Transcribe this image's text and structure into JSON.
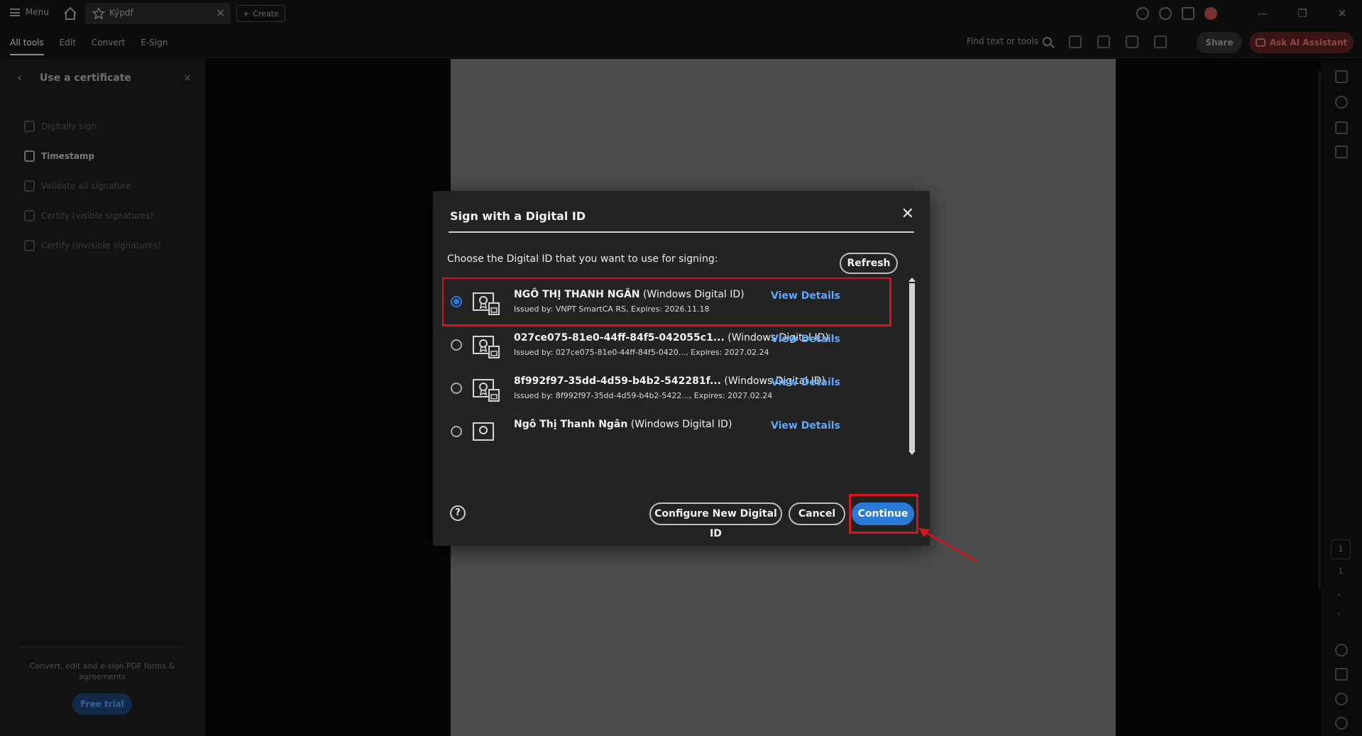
{
  "titlebar": {
    "menu_label": "Menu",
    "tab_label": "Kýpdf",
    "create_label": "Create",
    "window_controls": [
      "—",
      "❐",
      "✕"
    ]
  },
  "toolbar": {
    "tabs": [
      "All tools",
      "Edit",
      "Convert",
      "E-Sign"
    ],
    "find_label": "Find text or tools",
    "share_label": "Share",
    "ai_label": "Ask AI Assistant"
  },
  "left_panel": {
    "title": "Use a certificate",
    "items": [
      {
        "label": "Digitally sign"
      },
      {
        "label": "Timestamp"
      },
      {
        "label": "Validate all signature"
      },
      {
        "label": "Certify (visible signatures)"
      },
      {
        "label": "Certify (invisible signatures)"
      }
    ],
    "promo_text": "Convert, edit and e-sign PDF forms & agreements",
    "trial_label": "Free trial"
  },
  "right_rail": {
    "current_page": "1",
    "total_pages": "1"
  },
  "dialog": {
    "title": "Sign with a Digital ID",
    "prompt": "Choose the Digital ID that you want to use for signing:",
    "refresh_label": "Refresh",
    "ids": [
      {
        "name": "NGÔ THỊ THANH NGÂN",
        "type": "(Windows Digital ID)",
        "detail": "Issued by: VNPT SmartCA RS, Expires: 2026.11.18",
        "link": "View Details",
        "selected": true
      },
      {
        "name": "027ce075-81e0-44ff-84f5-042055c1...",
        "type": "(Windows Digital ID)",
        "detail": "Issued by: 027ce075-81e0-44ff-84f5-0420..., Expires: 2027.02.24",
        "link": "View Details",
        "selected": false
      },
      {
        "name": "8f992f97-35dd-4d59-b4b2-542281f...",
        "type": "(Windows Digital ID)",
        "detail": "Issued by: 8f992f97-35dd-4d59-b4b2-5422..., Expires: 2027.02.24",
        "link": "View Details",
        "selected": false
      },
      {
        "name": "Ngô Thị Thanh Ngân",
        "type": "(Windows Digital ID)",
        "detail": "",
        "link": "View Details",
        "selected": false
      }
    ],
    "help_glyph": "?",
    "configure_label": "Configure New Digital ID",
    "cancel_label": "Cancel",
    "continue_label": "Continue"
  },
  "colors": {
    "accent_blue": "#2a7ad8",
    "link_blue": "#5fa8ff",
    "highlight_red": "#d9121c",
    "dialog_bg": "#232323"
  }
}
